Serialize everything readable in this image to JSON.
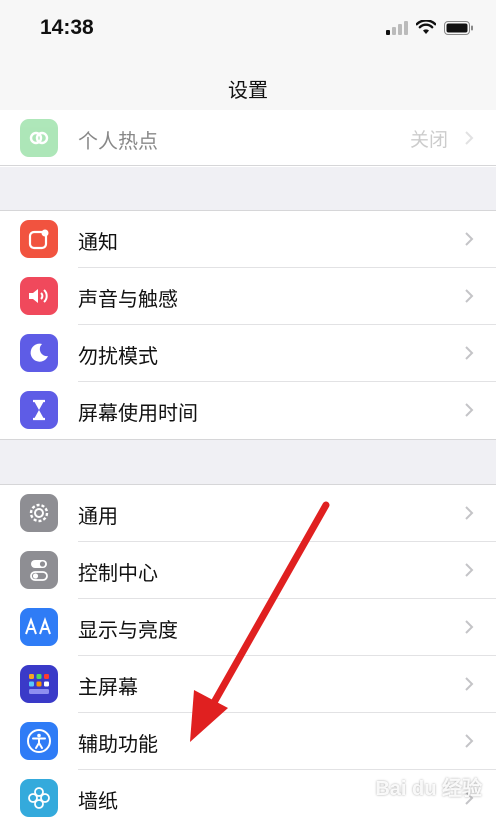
{
  "status_bar": {
    "time": "14:38"
  },
  "nav": {
    "title": "设置"
  },
  "groups": [
    {
      "items": [
        {
          "label": "个人热点",
          "value": "关闭",
          "icon": "hotspot-icon",
          "icon_color": "#5ecf73"
        }
      ]
    },
    {
      "items": [
        {
          "label": "通知",
          "icon": "notification-icon",
          "icon_color": "#f1533f"
        },
        {
          "label": "声音与触感",
          "icon": "sound-icon",
          "icon_color": "#f0495c"
        },
        {
          "label": "勿扰模式",
          "icon": "moon-icon",
          "icon_color": "#5e5ce6"
        },
        {
          "label": "屏幕使用时间",
          "icon": "hourglass-icon",
          "icon_color": "#5e5ce6"
        }
      ]
    },
    {
      "items": [
        {
          "label": "通用",
          "icon": "gear-icon",
          "icon_color": "#8e8e93"
        },
        {
          "label": "控制中心",
          "icon": "toggles-icon",
          "icon_color": "#8e8e93"
        },
        {
          "label": "显示与亮度",
          "icon": "text-size-icon",
          "icon_color": "#2f7cf6"
        },
        {
          "label": "主屏幕",
          "icon": "home-screen-icon",
          "icon_color": "#3a3ac8"
        },
        {
          "label": "辅助功能",
          "icon": "accessibility-icon",
          "icon_color": "#2f7cf6"
        },
        {
          "label": "墙纸",
          "icon": "wallpaper-icon",
          "icon_color": "#34aadc"
        }
      ]
    }
  ],
  "overlay": {
    "arrow_color": "#e02020",
    "watermark": "Bai du 经验"
  }
}
